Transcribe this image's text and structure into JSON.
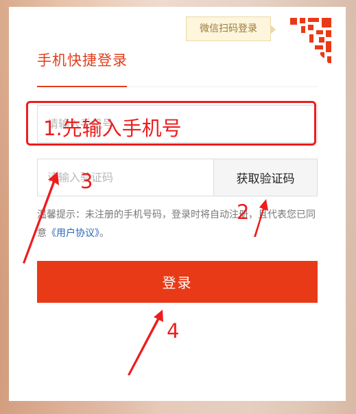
{
  "wechat_login": {
    "label": "微信扫码登录"
  },
  "tab": {
    "title": "手机快捷登录"
  },
  "phone_input": {
    "placeholder": "请输入手机号"
  },
  "code_input": {
    "placeholder": "请输入验证码"
  },
  "get_code_button": {
    "label": "获取验证码"
  },
  "notice": {
    "text": "温馨提示：未注册的手机号码，登录时将自动注册，且代表您已同意",
    "link": "《用户协议》",
    "suffix": "。"
  },
  "login_button": {
    "label": "登录"
  },
  "annotations": {
    "step1": "1.先输入手机号",
    "step2": "2",
    "step3": "3",
    "step4": "4"
  },
  "colors": {
    "accent": "#e93a17",
    "annotation": "#ef1c1c",
    "link": "#2a66b8"
  }
}
